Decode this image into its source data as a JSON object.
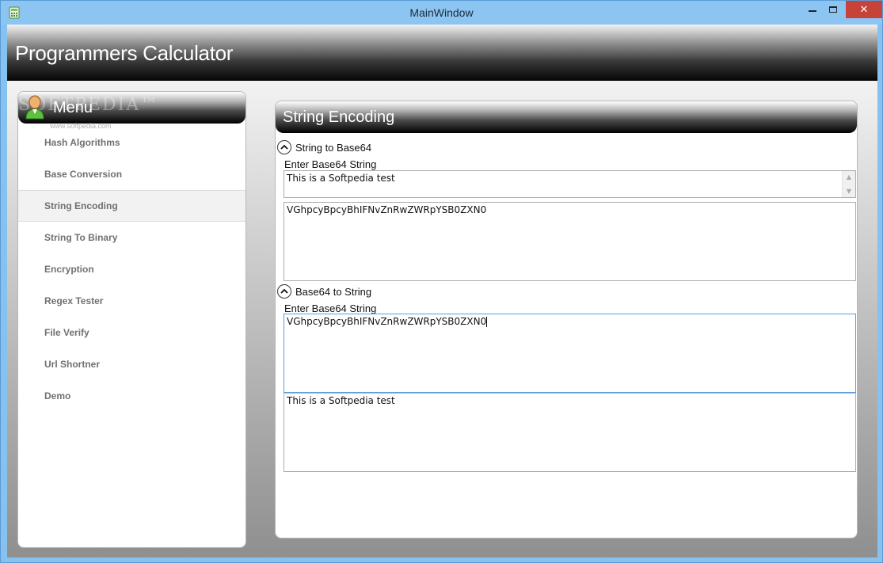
{
  "window": {
    "title": "MainWindow",
    "close_symbol": "✕"
  },
  "app": {
    "title": "Programmers Calculator"
  },
  "menu": {
    "title": "Menu",
    "watermark": "SOFTPEDIA™",
    "watermark_url": "www.softpedia.com",
    "items": [
      {
        "label": "Hash Algorithms"
      },
      {
        "label": "Base Conversion"
      },
      {
        "label": "String Encoding"
      },
      {
        "label": "String To Binary"
      },
      {
        "label": "Encryption"
      },
      {
        "label": "Regex Tester"
      },
      {
        "label": "File Verify"
      },
      {
        "label": "Url Shortner"
      },
      {
        "label": "Demo"
      }
    ],
    "active_item": "String Encoding"
  },
  "content": {
    "title": "String Encoding",
    "string_to_base64": {
      "header": "String to Base64",
      "input_label": "Enter Base64 String",
      "input_value": "This is a Softpedia test",
      "output_value": "VGhpcyBpcyBhIFNvZnRwZWRpYSB0ZXN0"
    },
    "base64_to_string": {
      "header": "Base64 to String",
      "input_label": "Enter Base64 String",
      "input_value": "VGhpcyBpcyBhIFNvZnRwZWRpYSB0ZXN0",
      "output_value": "This is a Softpedia test"
    }
  },
  "colors": {
    "titlebar": "#8dc5f2",
    "close_button": "#c7433a",
    "focus_border": "#569de5"
  }
}
